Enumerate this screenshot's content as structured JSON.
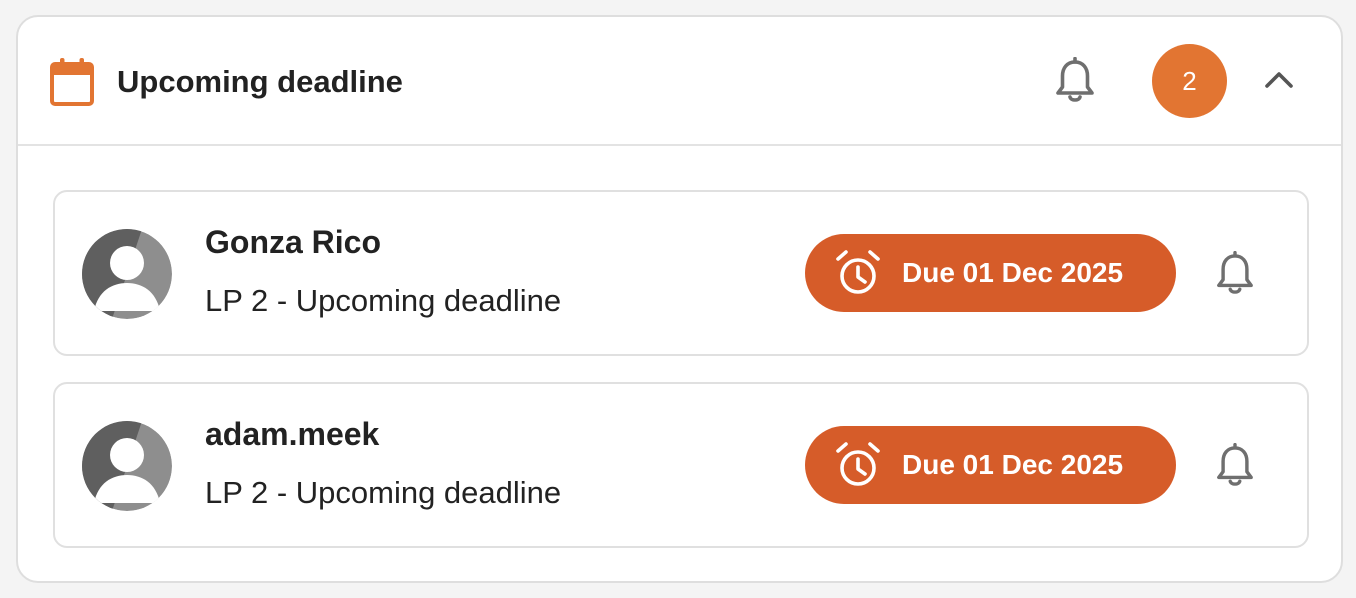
{
  "colors": {
    "accent": "#e27532",
    "due_badge": "#d65c29",
    "icon_gray": "#6f6f6f"
  },
  "header": {
    "icon": "calendar-icon",
    "title": "Upcoming deadline",
    "bell_icon": "bell-icon",
    "count": "2",
    "collapse_icon": "chevron-up-icon"
  },
  "items": [
    {
      "avatar_icon": "user-avatar-icon",
      "name": "Gonza Rico",
      "subtitle": "LP 2 - Upcoming deadline",
      "due_icon": "alarm-clock-icon",
      "due_label": "Due 01 Dec 2025",
      "bell_icon": "bell-icon"
    },
    {
      "avatar_icon": "user-avatar-icon",
      "name": "adam.meek",
      "subtitle": "LP 2 - Upcoming deadline",
      "due_icon": "alarm-clock-icon",
      "due_label": "Due 01 Dec 2025",
      "bell_icon": "bell-icon"
    }
  ]
}
